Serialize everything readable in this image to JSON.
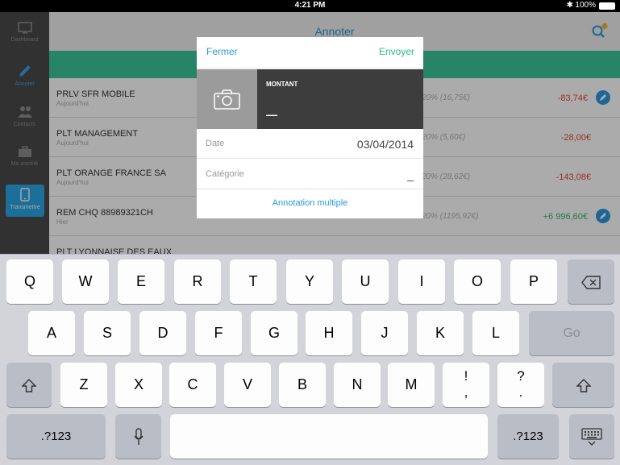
{
  "status_bar": {
    "time": "4:21 PM",
    "bluetooth": "✱",
    "battery": "100%"
  },
  "sidebar": {
    "items": [
      {
        "label": "Dashboard",
        "icon": "monitor-icon"
      },
      {
        "label": "Annoter",
        "icon": "pencil-icon"
      },
      {
        "label": "Contacts",
        "icon": "people-icon"
      },
      {
        "label": "Ma société",
        "icon": "briefcase-icon"
      },
      {
        "label": "Transmettre",
        "icon": "tablet-icon"
      }
    ]
  },
  "header": {
    "title": "Annoter",
    "icon": "search-tag-icon"
  },
  "transactions": [
    {
      "label": "PRLV SFR MOBILE",
      "date": "Aujourd'hui",
      "tax": "20% (16,75€)",
      "amount": "-83,74€"
    },
    {
      "label": "PLT MANAGEMENT",
      "date": "Aujourd'hui",
      "tax": "20% (5,60€)",
      "amount": "-28,00€"
    },
    {
      "label": "PLT ORANGE FRANCE SA",
      "date": "Aujourd'hui",
      "tax": "20% (28,62€)",
      "amount": "-143,08€"
    },
    {
      "label": "REM CHQ 88989321CH",
      "date": "Hier",
      "tax": "20% (1195,92€)",
      "amount": "+6 996,60€"
    },
    {
      "label": "PLT LYONNAISE DES EAUX",
      "date": "",
      "tax": "",
      "amount": ""
    }
  ],
  "modal": {
    "close_label": "Fermer",
    "send_label": "Envoyer",
    "amount_label": "MONTANT",
    "amount_value": "—",
    "date_label": "Date",
    "date_value": "03/04/2014",
    "category_label": "Catégorie",
    "category_value": "_",
    "multi_label": "Annotation multiple"
  },
  "keyboard": {
    "row1": [
      "Q",
      "W",
      "E",
      "R",
      "T",
      "Y",
      "U",
      "I",
      "O",
      "P"
    ],
    "row2": [
      "A",
      "S",
      "D",
      "F",
      "G",
      "H",
      "J",
      "K",
      "L"
    ],
    "row3": [
      "Z",
      "X",
      "C",
      "V",
      "B",
      "N",
      "M"
    ],
    "punct1": [
      "!",
      ","
    ],
    "punct2": [
      "?",
      "."
    ],
    "go_label": "Go",
    "numbers_label": ".?123"
  },
  "colors": {
    "accent_blue": "#2a9ad6",
    "accent_green": "#3cc59a",
    "negative": "#e5473b",
    "positive": "#39b56f"
  }
}
